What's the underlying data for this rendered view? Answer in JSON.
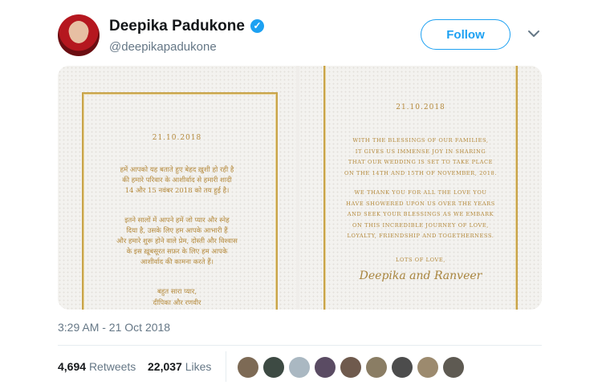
{
  "author": {
    "name": "Deepika Padukone",
    "handle": "@deepikapadukone",
    "verified": true
  },
  "follow_label": "Follow",
  "card_left": {
    "date": "21.10.2018",
    "para1": [
      "हमें आपको यह बताते हुए बेहद ख़ुशी हो रही है",
      "की हमारे परिवार के आशीर्वाद से हमारी शादी",
      "14 और 15 नवंबर 2018 को तय हुई है।"
    ],
    "para2": [
      "इतने सालों में आपने हमें जो प्यार और स्नेह",
      "दिया है, उसके लिए हम आपके आभारी हैं",
      "और हमारे शुरू होने वाले प्रेम, दोस्ती और विश्वास",
      "के इस ख़ूबसूरत सफ़र के लिए हम आपके",
      "आशीर्वाद की कामना करते हैं।"
    ],
    "closing": "बहुत सारा प्यार,",
    "signature": "दीपिका और रणवीर"
  },
  "card_right": {
    "date": "21.10.2018",
    "para1": [
      "WITH THE BLESSINGS OF OUR FAMILIES,",
      "IT GIVES US IMMENSE JOY IN SHARING",
      "THAT OUR WEDDING IS SET TO TAKE PLACE",
      "ON THE 14TH AND 15TH OF NOVEMBER, 2018."
    ],
    "para2": [
      "WE THANK YOU FOR ALL THE LOVE YOU",
      "HAVE SHOWERED UPON US OVER THE YEARS",
      "AND SEEK YOUR BLESSINGS AS WE EMBARK",
      "ON THIS INCREDIBLE JOURNEY OF LOVE,",
      "LOYALTY, FRIENDSHIP AND TOGETHERNESS."
    ],
    "closing": "LOTS OF LOVE,",
    "signature": "Deepika and Ranveer"
  },
  "timestamp": "3:29 AM - 21 Oct 2018",
  "stats": {
    "retweets_count": "4,694",
    "retweets_label": "Retweets",
    "likes_count": "22,037",
    "likes_label": "Likes"
  },
  "liker_avatars": [
    "#7d6a55",
    "#3d4a43",
    "#aab8c2",
    "#5a4b63",
    "#6f5a4d",
    "#8a7d64",
    "#4c4c4c",
    "#9c8a6e",
    "#5e5a52"
  ],
  "colors": {
    "accent": "#1da1f2",
    "gold": "#b58a3c",
    "muted": "#657786"
  }
}
